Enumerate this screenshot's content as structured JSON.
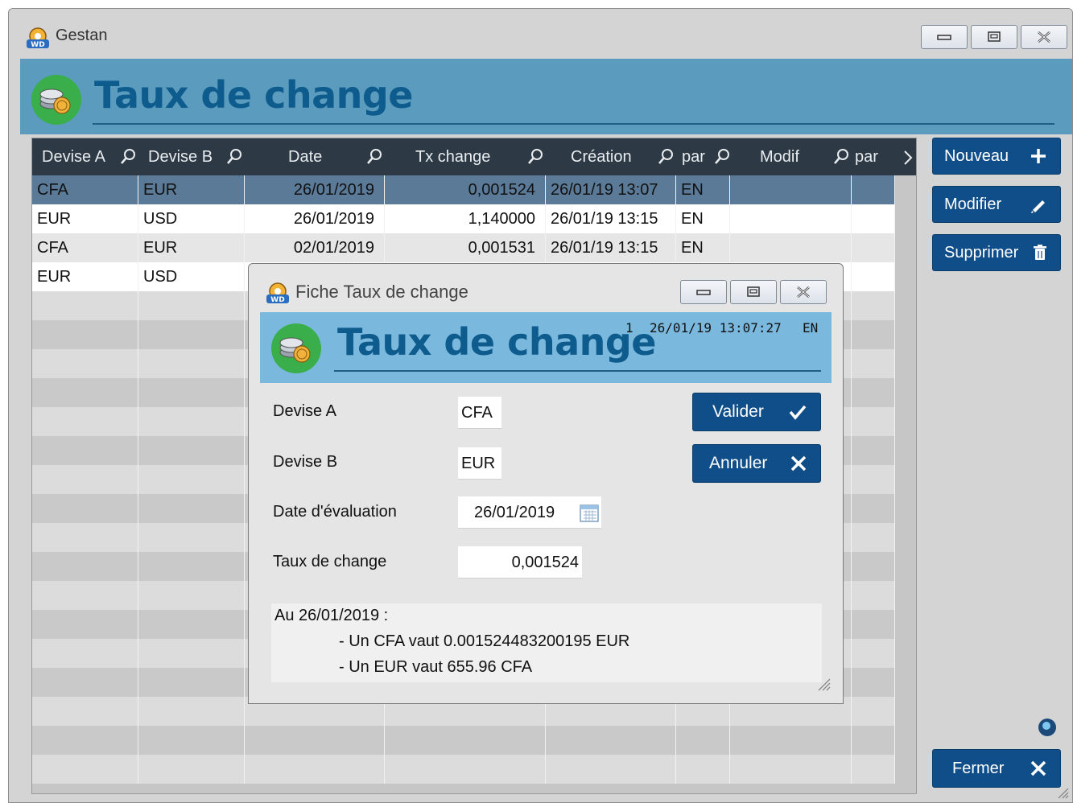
{
  "window": {
    "title": "Gestan",
    "banner_title": "Taux de change",
    "colors": {
      "banner": "#5b9bbe",
      "header": "#2d3945",
      "button": "#0f4e88",
      "selected_row": "#5a7a98"
    }
  },
  "table": {
    "columns": [
      "Devise A",
      "Devise B",
      "Date",
      "Tx change",
      "Création",
      "par",
      "Modif",
      "par"
    ],
    "rows": [
      {
        "devise_a": "CFA",
        "devise_b": "EUR",
        "date": "26/01/2019",
        "tx": "0,001524",
        "creation": "26/01/19 13:07",
        "par": "EN",
        "modif": "",
        "par2": ""
      },
      {
        "devise_a": "EUR",
        "devise_b": "USD",
        "date": "26/01/2019",
        "tx": "1,140000",
        "creation": "26/01/19 13:15",
        "par": "EN",
        "modif": "",
        "par2": ""
      },
      {
        "devise_a": "CFA",
        "devise_b": "EUR",
        "date": "02/01/2019",
        "tx": "0,001531",
        "creation": "26/01/19 13:15",
        "par": "EN",
        "modif": "",
        "par2": ""
      },
      {
        "devise_a": "EUR",
        "devise_b": "USD",
        "date": "",
        "tx": "",
        "creation": "",
        "par": "",
        "modif": "",
        "par2": ""
      }
    ]
  },
  "side_buttons": {
    "new": "Nouveau",
    "edit": "Modifier",
    "delete": "Supprimer",
    "close": "Fermer"
  },
  "dialog": {
    "title": "Fiche Taux de change",
    "banner_title": "Taux de change",
    "info": {
      "id": "1",
      "timestamp": "26/01/19 13:07:27",
      "user": "EN"
    },
    "labels": {
      "devise_a": "Devise A",
      "devise_b": "Devise B",
      "date": "Date d'évaluation",
      "taux": "Taux de change"
    },
    "values": {
      "devise_a": "CFA",
      "devise_b": "EUR",
      "date": "26/01/2019",
      "taux": "0,001524"
    },
    "buttons": {
      "ok": "Valider",
      "cancel": "Annuler"
    },
    "memo": {
      "line1": "Au 26/01/2019 :",
      "line2": "- Un CFA vaut 0.001524483200195 EUR",
      "line3": "- Un EUR vaut 655.96 CFA"
    }
  }
}
